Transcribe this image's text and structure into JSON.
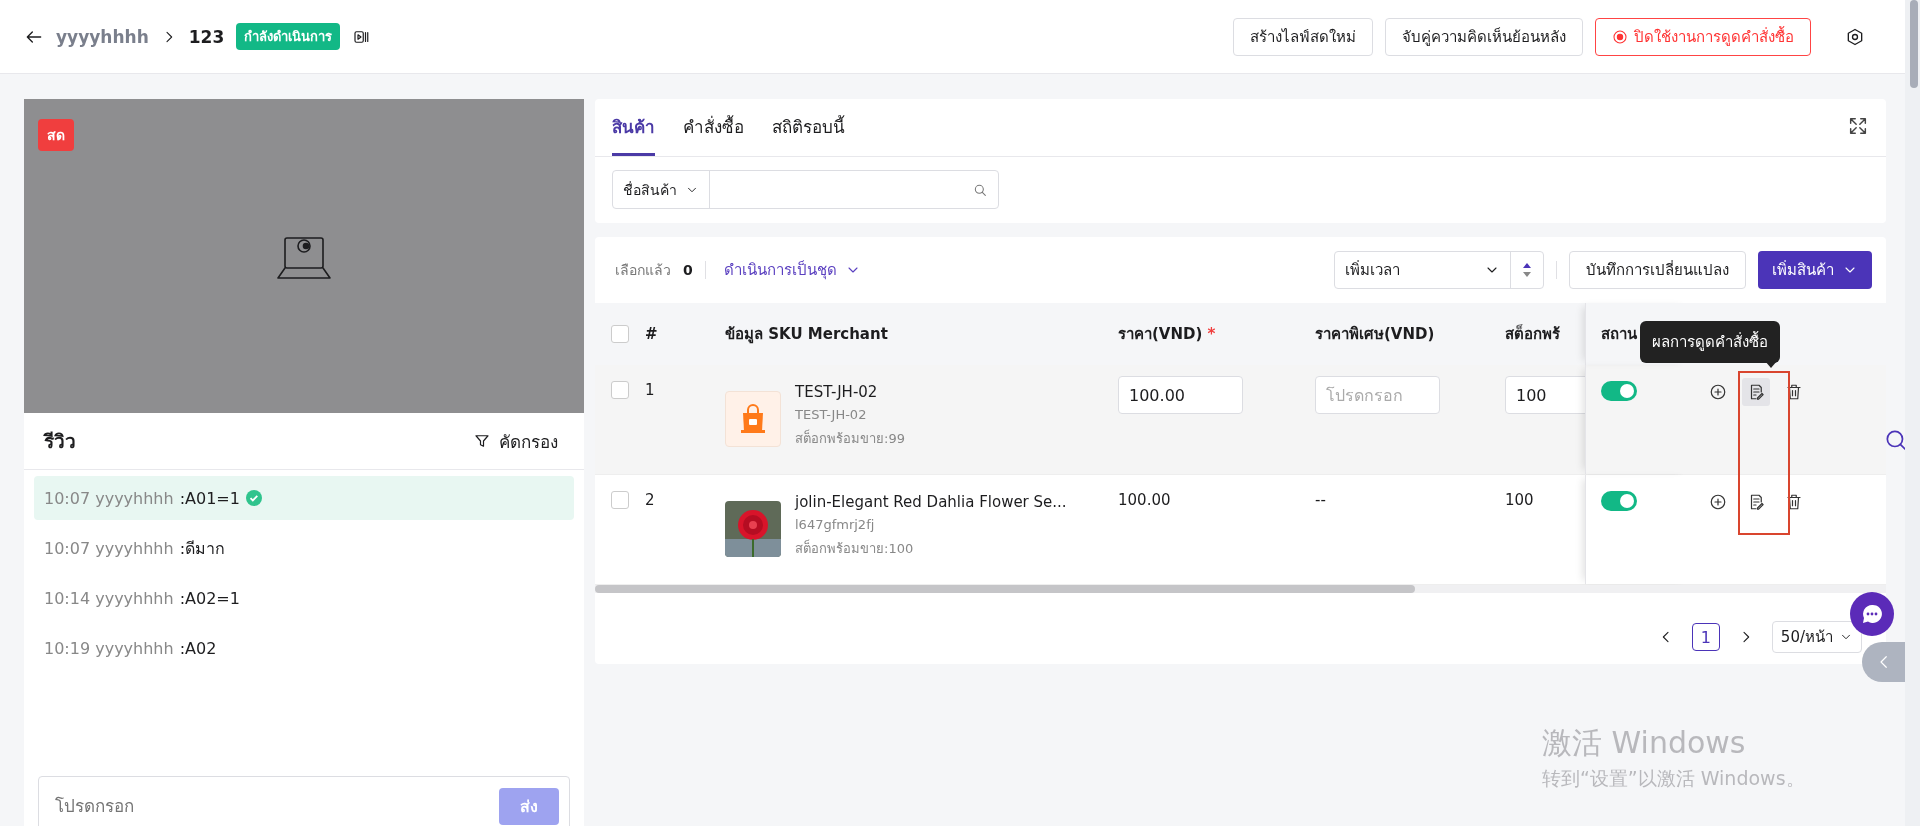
{
  "header": {
    "breadcrumb": "yyyyhhhh",
    "session": "123",
    "status": "กำลังดำเนินการ",
    "buttons": [
      {
        "label": "สร้างไลฟ์สดใหม่",
        "kind": "default"
      },
      {
        "label": "จับคู่ความคิดเห็นย้อนหลัง",
        "kind": "default"
      },
      {
        "label": "ปิดใช้งานการดูดคำสั่งซื้อ",
        "kind": "danger"
      }
    ]
  },
  "video": {
    "badge": "สด"
  },
  "reviews": {
    "title": "รีวิว",
    "filter": "คัดกรอง",
    "items": [
      {
        "time": "10:07",
        "user": "yyyyhhhh",
        "text": ":A01=1",
        "selected": true,
        "verified": true
      },
      {
        "time": "10:07",
        "user": "yyyyhhhh",
        "text": ":ดีมาก",
        "selected": false,
        "verified": false
      },
      {
        "time": "10:14",
        "user": "yyyyhhhh",
        "text": ":A02=1",
        "selected": false,
        "verified": false
      },
      {
        "time": "10:19",
        "user": "yyyyhhhh",
        "text": ":A02",
        "selected": false,
        "verified": false
      }
    ],
    "placeholder": "โปรดกรอก",
    "send": "ส่ง"
  },
  "tabs": [
    {
      "label": "สินค้า",
      "selected": true
    },
    {
      "label": "คำสั่งซื้อ",
      "selected": false
    },
    {
      "label": "สถิติรอบนี้",
      "selected": false
    }
  ],
  "search": {
    "category": "ชื่อสินค้า"
  },
  "toolbar": {
    "selected_label": "เลือกแล้ว",
    "selected_count": "0",
    "batch": "ดำเนินการเป็นชุด",
    "sort": "เพิ่มเวลา",
    "save": "บันทึกการเปลี่ยนแปลง",
    "add": "เพิ่มสินค้า"
  },
  "table": {
    "all_checked": false,
    "columns": [
      {
        "label": "#"
      },
      {
        "label": "ข้อมูล SKU Merchant"
      },
      {
        "label": "ราคา(VND)",
        "mark": "*"
      },
      {
        "label": "ราคาพิเศษ(VND)"
      },
      {
        "label": "สต็อกพร้"
      },
      {
        "label": "สถาน"
      }
    ],
    "rows": [
      {
        "index": "1",
        "name": "TEST-JH-02",
        "sku": "TEST-JH-02",
        "stock_note": "สต็อกพร้อมขาย:99",
        "kind": "icon",
        "checked": false,
        "editable": true,
        "hovered": true,
        "price": "100.00",
        "special_placeholder": "โปรดกรอก",
        "stock": "100",
        "status_on": true
      },
      {
        "index": "2",
        "name": "jolin-Elegant Red Dahlia Flower Se...",
        "sku": "l647gfmrj2fj",
        "stock_note": "สต็อกพร้อมขาย:100",
        "checked": false,
        "editable": false,
        "hovered": false,
        "price": "100.00",
        "special": "--",
        "stock": "100",
        "status_on": true
      }
    ],
    "tooltip": "ผลการดูดคำสั่งซื้อ"
  },
  "pagination": {
    "pages": [
      {
        "label": "1",
        "selected": true
      }
    ],
    "page_size": "50/หน้า"
  },
  "watermark": {
    "title": "激活 Windows",
    "subtitle": "转到“设置”以激活 Windows。"
  }
}
